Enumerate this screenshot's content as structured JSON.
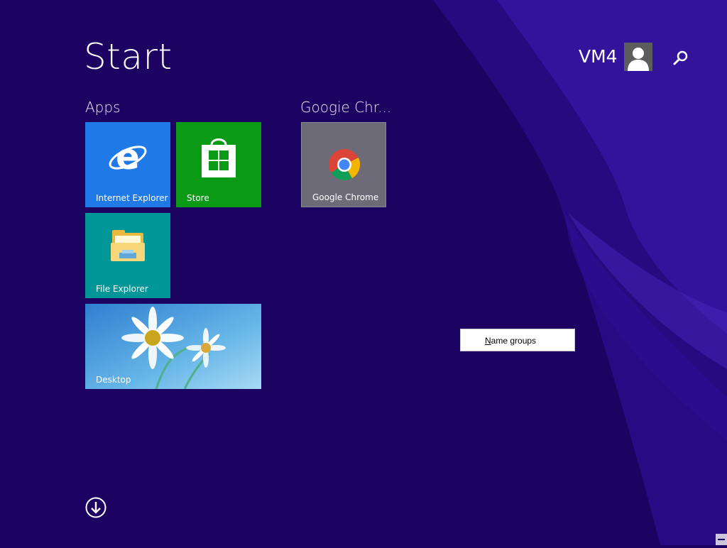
{
  "screen": {
    "title": "Start",
    "user_name": "VM4"
  },
  "groups": {
    "apps": "Apps",
    "chrome": "Googie Chr..."
  },
  "tiles": {
    "internet_explorer": "Internet Explorer",
    "store": "Store",
    "google_chrome": "Google Chrome",
    "file_explorer": "File Explorer",
    "desktop": "Desktop"
  },
  "context_menu": {
    "item_access_key": "N",
    "item_rest": "ame groups"
  },
  "icons": {
    "user": "user-avatar-icon",
    "search": "search-icon",
    "all_apps": "down-arrow-circle-icon"
  },
  "colors": {
    "background": "#1c0362",
    "ie_tile": "#1f7ae8",
    "store_tile": "#0a9a15",
    "chrome_tile": "#6d6b78",
    "explorer_tile": "#019697"
  }
}
